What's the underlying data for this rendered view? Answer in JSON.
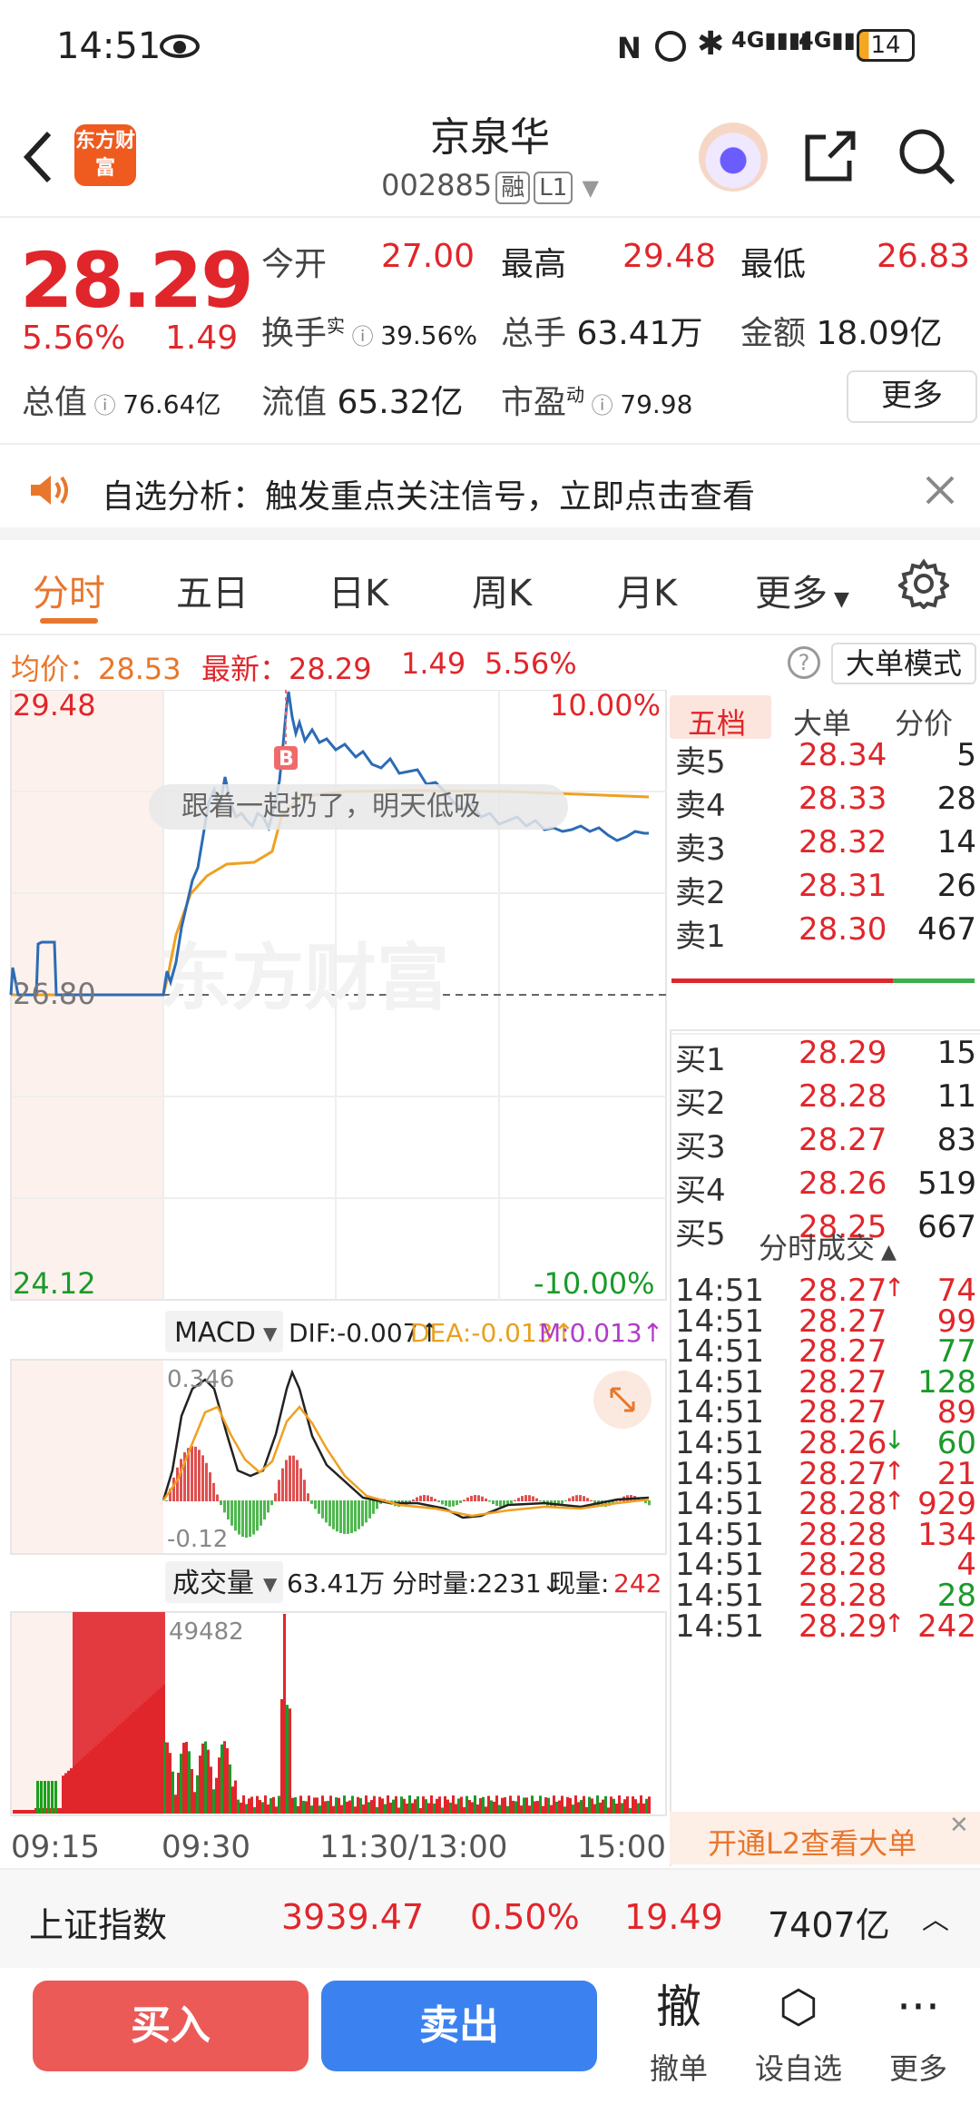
{
  "status": {
    "time": "14:51",
    "battery": "14"
  },
  "header": {
    "logo": "东方财富",
    "title": "京泉华",
    "code": "002885",
    "tag1": "融",
    "tag2": "L1"
  },
  "quote": {
    "price": "28.29",
    "pct": "5.56%",
    "chg": "1.49",
    "open_label": "今开",
    "open": "27.00",
    "high_label": "最高",
    "high": "29.48",
    "low_label": "最低",
    "low": "26.83",
    "turnover_label": "换手",
    "turnover_sup": "实",
    "turnover": "39.56%",
    "vol_label": "总手",
    "vol": "63.41万",
    "amount_label": "金额",
    "amount": "18.09亿",
    "mcap_label": "总值",
    "mcap": "76.64亿",
    "float_label": "流值",
    "float": "65.32亿",
    "pe_label": "市盈",
    "pe_sup": "动",
    "pe": "79.98",
    "more": "更多"
  },
  "notice": {
    "text": "自选分析：触发重点关注信号，立即点击查看"
  },
  "tabs": [
    "分时",
    "五日",
    "日K",
    "周K",
    "月K",
    "更多"
  ],
  "info": {
    "avg_label": "均价：",
    "avg": "28.53",
    "last_label": "最新：",
    "last": "28.29",
    "chg": "1.49",
    "pct": "5.56%",
    "mode": "大单模式"
  },
  "chart": {
    "y_top": "29.48",
    "y_mid": "26.80",
    "y_bot": "24.12",
    "pct_top": "10.00%",
    "pct_bot": "-10.00%",
    "tip": "跟着一起扔了，明天低吸",
    "marker": "B",
    "watermark": "东方财富",
    "macd_label": "MACD",
    "dif": "DIF:-0.007↑",
    "dea": "DEA:-0.013↑",
    "m": "M:0.013↑",
    "macd_top": "0.346",
    "macd_bot": "-0.12",
    "vol_label": "成交量",
    "vol_total": "63.41万",
    "vol_min": "分时量:2231↓",
    "vol_now_label": "现量:",
    "vol_now": "242",
    "vol_max": "49482",
    "x_labels": [
      "09:15",
      "09:30",
      "11:30/13:00",
      "15:00"
    ]
  },
  "book": {
    "tabs": [
      "五档",
      "大单",
      "分价"
    ],
    "sells": [
      {
        "l": "卖5",
        "p": "28.34",
        "v": "5"
      },
      {
        "l": "卖4",
        "p": "28.33",
        "v": "28"
      },
      {
        "l": "卖3",
        "p": "28.32",
        "v": "14"
      },
      {
        "l": "卖2",
        "p": "28.31",
        "v": "26"
      },
      {
        "l": "卖1",
        "p": "28.30",
        "v": "467"
      }
    ],
    "buys": [
      {
        "l": "买1",
        "p": "28.29",
        "v": "15"
      },
      {
        "l": "买2",
        "p": "28.28",
        "v": "11"
      },
      {
        "l": "买3",
        "p": "28.27",
        "v": "83"
      },
      {
        "l": "买4",
        "p": "28.26",
        "v": "519"
      },
      {
        "l": "买5",
        "p": "28.25",
        "v": "667"
      }
    ],
    "ticks_title": "分时成交",
    "ticks": [
      {
        "t": "14:51",
        "p": "28.27",
        "a": "↑",
        "v": "74",
        "pc": "red",
        "vc": "red"
      },
      {
        "t": "14:51",
        "p": "28.27",
        "a": "",
        "v": "99",
        "pc": "red",
        "vc": "red"
      },
      {
        "t": "14:51",
        "p": "28.27",
        "a": "",
        "v": "77",
        "pc": "red",
        "vc": "green"
      },
      {
        "t": "14:51",
        "p": "28.27",
        "a": "",
        "v": "128",
        "pc": "red",
        "vc": "green"
      },
      {
        "t": "14:51",
        "p": "28.27",
        "a": "",
        "v": "89",
        "pc": "red",
        "vc": "red"
      },
      {
        "t": "14:51",
        "p": "28.26",
        "a": "↓",
        "v": "60",
        "pc": "red",
        "vc": "green"
      },
      {
        "t": "14:51",
        "p": "28.27",
        "a": "↑",
        "v": "21",
        "pc": "red",
        "vc": "red"
      },
      {
        "t": "14:51",
        "p": "28.28",
        "a": "↑",
        "v": "929",
        "pc": "red",
        "vc": "red"
      },
      {
        "t": "14:51",
        "p": "28.28",
        "a": "",
        "v": "134",
        "pc": "red",
        "vc": "red"
      },
      {
        "t": "14:51",
        "p": "28.28",
        "a": "",
        "v": "4",
        "pc": "red",
        "vc": "red"
      },
      {
        "t": "14:51",
        "p": "28.28",
        "a": "",
        "v": "28",
        "pc": "red",
        "vc": "green"
      },
      {
        "t": "14:51",
        "p": "28.29",
        "a": "↑",
        "v": "242",
        "pc": "red",
        "vc": "red"
      }
    ],
    "l2": "开通L2查看大单"
  },
  "index": {
    "name": "上证指数",
    "value": "3939.47",
    "pct": "0.50%",
    "chg": "19.49",
    "amount": "7407亿"
  },
  "bottom": {
    "buy": "买入",
    "sell": "卖出",
    "cancel_glyph": "撤",
    "cancel": "撤单",
    "watch": "设自选",
    "more": "更多"
  }
}
